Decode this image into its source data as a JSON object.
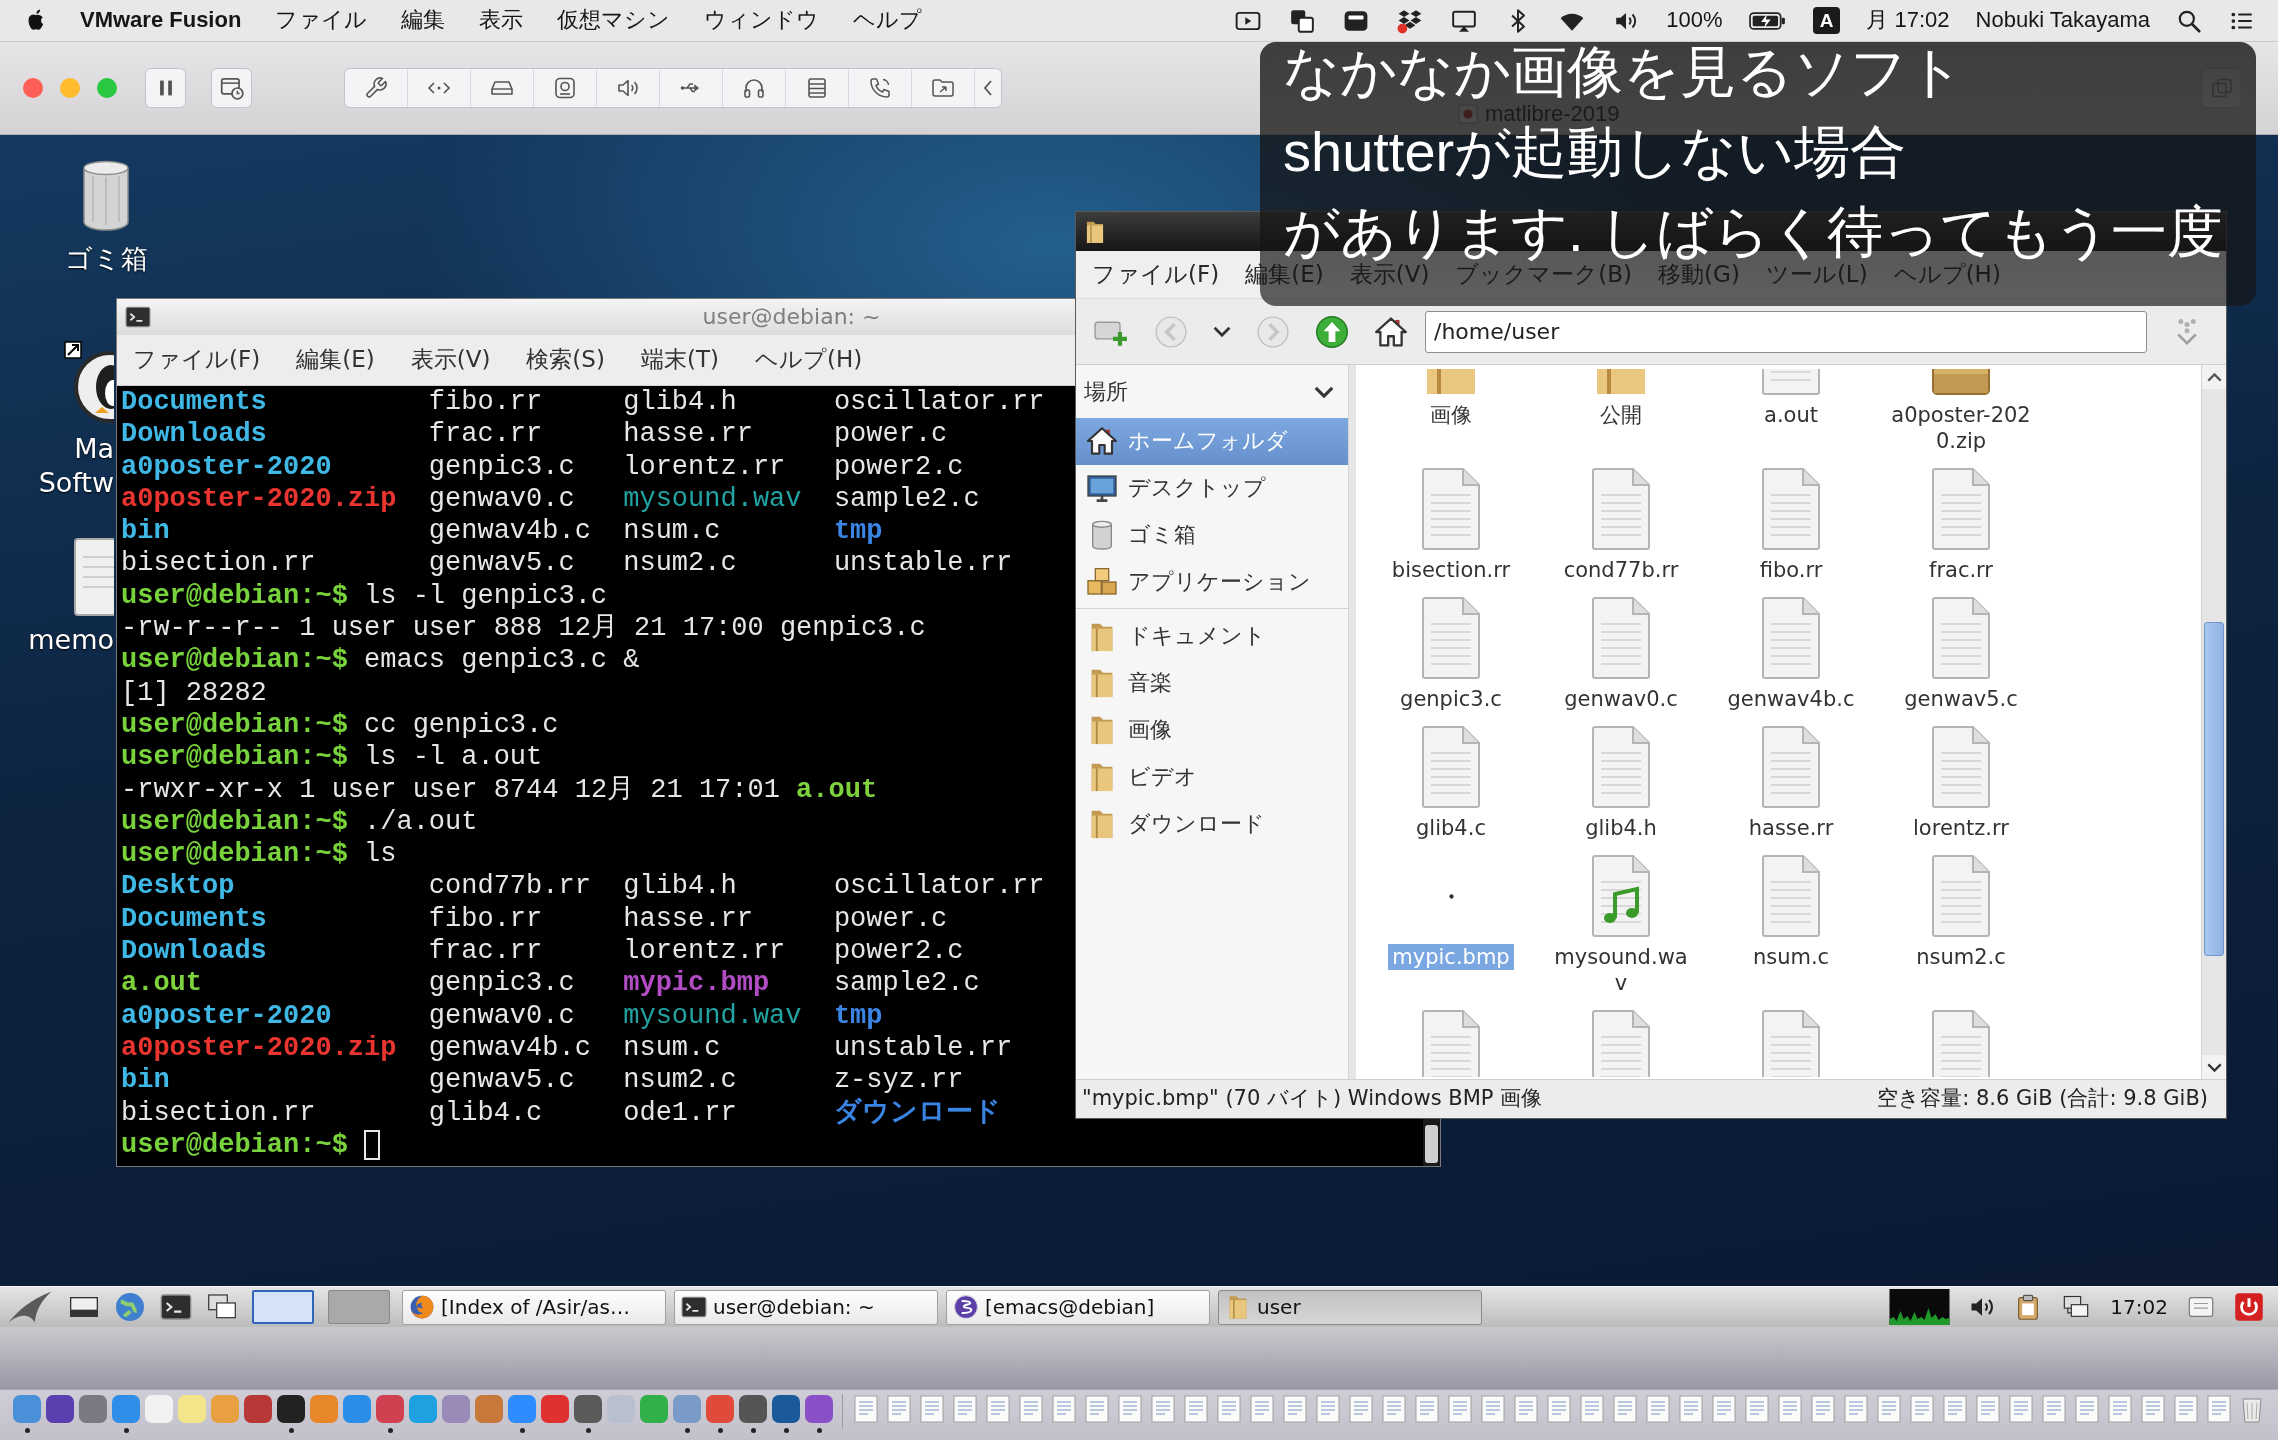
{
  "mac_menubar": {
    "app_name": "VMware Fusion",
    "menus": [
      "ファイル",
      "編集",
      "表示",
      "仮想マシン",
      "ウィンドウ",
      "ヘルプ"
    ],
    "battery": "100%",
    "input_source": "A",
    "clock": "月 17:02",
    "user": "Nobuki Takayama"
  },
  "vm_toolbar": {
    "title": "matlibre-2019"
  },
  "desktop_icons": [
    {
      "kind": "trash",
      "label_lines": [
        "ゴミ箱"
      ]
    },
    {
      "kind": "app",
      "label_lines": [
        "Ma",
        "Softw"
      ]
    },
    {
      "kind": "document",
      "label_lines": [
        "memo"
      ]
    }
  ],
  "terminal": {
    "title": "user@debian: ~",
    "menus": [
      "ファイル(F)",
      "編集(E)",
      "表示(V)",
      "検索(S)",
      "端末(T)",
      "ヘルプ(H)"
    ],
    "lines": [
      {
        "kind": "listing",
        "cells": [
          {
            "text": "Documents",
            "kind": "link"
          },
          {
            "text": "fibo.rr",
            "kind": "file"
          },
          {
            "text": "glib4.h",
            "kind": "file"
          },
          {
            "text": "oscillator.rr",
            "kind": "file"
          }
        ]
      },
      {
        "kind": "listing",
        "cells": [
          {
            "text": "Downloads",
            "kind": "link"
          },
          {
            "text": "frac.rr",
            "kind": "file"
          },
          {
            "text": "hasse.rr",
            "kind": "file"
          },
          {
            "text": "power.c",
            "kind": "file"
          }
        ]
      },
      {
        "kind": "listing",
        "cells": [
          {
            "text": "a0poster-2020",
            "kind": "link"
          },
          {
            "text": "genpic3.c",
            "kind": "file"
          },
          {
            "text": "lorentz.rr",
            "kind": "file"
          },
          {
            "text": "power2.c",
            "kind": "file"
          }
        ]
      },
      {
        "kind": "listing",
        "cells": [
          {
            "text": "a0poster-2020.zip",
            "kind": "archive"
          },
          {
            "text": "genwav0.c",
            "kind": "file"
          },
          {
            "text": "mysound.wav",
            "kind": "audio"
          },
          {
            "text": "sample2.c",
            "kind": "file"
          }
        ]
      },
      {
        "kind": "listing",
        "cells": [
          {
            "text": "bin",
            "kind": "link"
          },
          {
            "text": "genwav4b.c",
            "kind": "file"
          },
          {
            "text": "nsum.c",
            "kind": "file"
          },
          {
            "text": "tmp",
            "kind": "dir"
          }
        ]
      },
      {
        "kind": "listing",
        "cells": [
          {
            "text": "bisection.rr",
            "kind": "file"
          },
          {
            "text": "genwav5.c",
            "kind": "file"
          },
          {
            "text": "nsum2.c",
            "kind": "file"
          },
          {
            "text": "unstable.rr",
            "kind": "file"
          }
        ]
      },
      {
        "kind": "prompt",
        "prompt": "user@debian:~$",
        "command": "ls -l genpic3.c"
      },
      {
        "kind": "output",
        "text": "-rw-r--r-- 1 user user 888 12月 21 17:00 genpic3.c"
      },
      {
        "kind": "prompt",
        "prompt": "user@debian:~$",
        "command": "emacs genpic3.c &"
      },
      {
        "kind": "output",
        "text": "[1] 28282"
      },
      {
        "kind": "prompt",
        "prompt": "user@debian:~$",
        "command": "cc genpic3.c"
      },
      {
        "kind": "prompt",
        "prompt": "user@debian:~$",
        "command": "ls -l a.out"
      },
      {
        "kind": "output",
        "text": "-rwxr-xr-x 1 user user 8744 12月 21 17:01",
        "file": {
          "text": "a.out",
          "kind": "exec"
        }
      },
      {
        "kind": "prompt",
        "prompt": "user@debian:~$",
        "command": "./a.out"
      },
      {
        "kind": "prompt",
        "prompt": "user@debian:~$",
        "command": "ls"
      },
      {
        "kind": "listing",
        "cells": [
          {
            "text": "Desktop",
            "kind": "link"
          },
          {
            "text": "cond77b.rr",
            "kind": "file"
          },
          {
            "text": "glib4.h",
            "kind": "file"
          },
          {
            "text": "oscillator.rr",
            "kind": "file"
          }
        ]
      },
      {
        "kind": "listing",
        "cells": [
          {
            "text": "Documents",
            "kind": "link"
          },
          {
            "text": "fibo.rr",
            "kind": "file"
          },
          {
            "text": "hasse.rr",
            "kind": "file"
          },
          {
            "text": "power.c",
            "kind": "file"
          }
        ]
      },
      {
        "kind": "listing",
        "cells": [
          {
            "text": "Downloads",
            "kind": "link"
          },
          {
            "text": "frac.rr",
            "kind": "file"
          },
          {
            "text": "lorentz.rr",
            "kind": "file"
          },
          {
            "text": "power2.c",
            "kind": "file"
          }
        ]
      },
      {
        "kind": "listing",
        "cells": [
          {
            "text": "a.out",
            "kind": "exec"
          },
          {
            "text": "genpic3.c",
            "kind": "file"
          },
          {
            "text": "mypic.bmp",
            "kind": "image"
          },
          {
            "text": "sample2.c",
            "kind": "file"
          }
        ]
      },
      {
        "kind": "listing",
        "cells": [
          {
            "text": "a0poster-2020",
            "kind": "link"
          },
          {
            "text": "genwav0.c",
            "kind": "file"
          },
          {
            "text": "mysound.wav",
            "kind": "audio"
          },
          {
            "text": "tmp",
            "kind": "dir"
          }
        ]
      },
      {
        "kind": "listing",
        "cells": [
          {
            "text": "a0poster-2020.zip",
            "kind": "archive"
          },
          {
            "text": "genwav4b.c",
            "kind": "file"
          },
          {
            "text": "nsum.c",
            "kind": "file"
          },
          {
            "text": "unstable.rr",
            "kind": "file"
          }
        ]
      },
      {
        "kind": "listing",
        "cells": [
          {
            "text": "bin",
            "kind": "link"
          },
          {
            "text": "genwav5.c",
            "kind": "file"
          },
          {
            "text": "nsum2.c",
            "kind": "file"
          },
          {
            "text": "z-syz.rr",
            "kind": "file"
          }
        ]
      },
      {
        "kind": "listing",
        "cells": [
          {
            "text": "bisection.rr",
            "kind": "file"
          },
          {
            "text": "glib4.c",
            "kind": "file"
          },
          {
            "text": "ode1.rr",
            "kind": "file"
          },
          {
            "text": "ダウンロード",
            "kind": "dir"
          }
        ]
      },
      {
        "kind": "prompt",
        "prompt": "user@debian:~$",
        "cursor": true
      }
    ]
  },
  "file_manager": {
    "menus": [
      "ファイル(F)",
      "編集(E)",
      "表示(V)",
      "ブックマーク(B)",
      "移動(G)",
      "ツール(L)",
      "ヘルプ(H)"
    ],
    "location": "/home/user",
    "places_header": "場所",
    "places": [
      {
        "kind": "home",
        "label": "ホームフォルダ",
        "selected": true
      },
      {
        "kind": "desktop",
        "label": "デスクトップ",
        "selected": false
      },
      {
        "kind": "trash",
        "label": "ゴミ箱",
        "selected": false
      },
      {
        "kind": "applications",
        "label": "アプリケーション",
        "selected": false
      }
    ],
    "bookmarks": [
      {
        "label": "ドキュメント",
        "selected": false
      },
      {
        "label": "音楽",
        "selected": false
      },
      {
        "label": "画像",
        "selected": false
      },
      {
        "label": "ビデオ",
        "selected": false
      },
      {
        "label": "ダウンロード",
        "selected": false
      }
    ],
    "items": [
      {
        "kind": "folder",
        "label": "画像",
        "selected": false
      },
      {
        "kind": "folder",
        "label": "公開",
        "selected": false
      },
      {
        "kind": "exec",
        "label": "a.out",
        "selected": false
      },
      {
        "kind": "archive",
        "label": "a0poster-2020.zip",
        "selected": false
      },
      {
        "kind": "file",
        "label": "bisection.rr",
        "selected": false
      },
      {
        "kind": "file",
        "label": "cond77b.rr",
        "selected": false
      },
      {
        "kind": "file",
        "label": "fibo.rr",
        "selected": false
      },
      {
        "kind": "file",
        "label": "frac.rr",
        "selected": false
      },
      {
        "kind": "file",
        "label": "genpic3.c",
        "selected": false
      },
      {
        "kind": "file",
        "label": "genwav0.c",
        "selected": false
      },
      {
        "kind": "file",
        "label": "genwav4b.c",
        "selected": false
      },
      {
        "kind": "file",
        "label": "genwav5.c",
        "selected": false
      },
      {
        "kind": "file",
        "label": "glib4.c",
        "selected": false
      },
      {
        "kind": "file",
        "label": "glib4.h",
        "selected": false
      },
      {
        "kind": "file",
        "label": "hasse.rr",
        "selected": false
      },
      {
        "kind": "file",
        "label": "lorentz.rr",
        "selected": false
      },
      {
        "kind": "image",
        "label": "mypic.bmp",
        "selected": true
      },
      {
        "kind": "audio",
        "label": "mysound.wav",
        "selected": false
      },
      {
        "kind": "file",
        "label": "nsum.c",
        "selected": false
      },
      {
        "kind": "file",
        "label": "nsum2.c",
        "selected": false
      },
      {
        "kind": "file",
        "selected": false
      },
      {
        "kind": "file",
        "selected": false
      },
      {
        "kind": "file",
        "selected": false
      },
      {
        "kind": "file",
        "selected": false
      }
    ],
    "status_left": "\"mypic.bmp\" (70 バイト) Windows BMP 画像",
    "status_right": "空き容量: 8.6 GiB (合計: 9.8 GiB)"
  },
  "caption": {
    "lines": [
      "なかなか画像を見るソフト",
      "shutterが起動しない場合",
      "があります. しばらく待ってもう一度"
    ]
  },
  "taskbar": {
    "workspaces": [
      {
        "selected": true
      },
      {
        "selected": false
      }
    ],
    "tasks": [
      {
        "kind": "browser",
        "label": "[Index of /Asir/as…",
        "selected": false
      },
      {
        "kind": "terminal",
        "label": "user@debian: ~",
        "selected": false
      },
      {
        "kind": "editor",
        "label": "[emacs@debian]",
        "selected": false
      },
      {
        "kind": "folder",
        "label": "user",
        "selected": true
      }
    ],
    "clock": "17:02"
  },
  "dock": {
    "apps": [
      {
        "color": "#4a90d9",
        "running": true
      },
      {
        "color": "#5a3fb0",
        "running": false
      },
      {
        "color": "#7a7a84",
        "running": false
      },
      {
        "color": "#2f8ee8",
        "running": true
      },
      {
        "color": "#f2f2f2",
        "running": false
      },
      {
        "color": "#f4e58a",
        "running": false
      },
      {
        "color": "#e8a040",
        "running": false
      },
      {
        "color": "#b83838",
        "running": false
      },
      {
        "color": "#222222",
        "running": true
      },
      {
        "color": "#e8862a",
        "running": false
      },
      {
        "color": "#2a8ee8",
        "running": false
      },
      {
        "color": "#d04050",
        "running": true
      },
      {
        "color": "#1fa0e0",
        "running": false
      },
      {
        "color": "#9a8ab8",
        "running": false
      },
      {
        "color": "#c8783a",
        "running": false
      },
      {
        "color": "#2d8cff",
        "running": true
      },
      {
        "color": "#e03030",
        "running": false
      },
      {
        "color": "#5a5a5a",
        "running": true
      },
      {
        "color": "#b8c0d0",
        "running": false
      },
      {
        "color": "#30b048",
        "running": false
      },
      {
        "color": "#7a9ac8",
        "running": true
      },
      {
        "color": "#e04a3a",
        "running": true
      },
      {
        "color": "#555555",
        "running": true
      },
      {
        "color": "#1a5a9a",
        "running": true
      },
      {
        "color": "#8a50c8",
        "running": true
      }
    ]
  }
}
